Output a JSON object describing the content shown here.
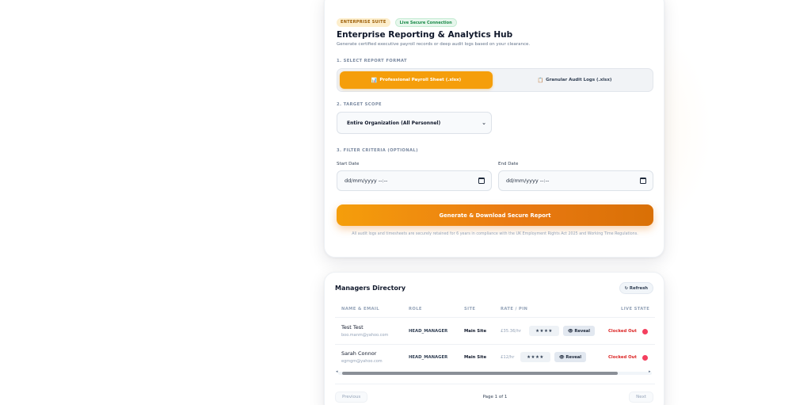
{
  "report": {
    "badge_enterprise": "ENTERPRISE SUITE",
    "badge_secure": "Live Secure Connection",
    "title": "Enterprise Reporting & Analytics Hub",
    "subtitle": "Generate certified executive payroll records or deep audit logs based on your clearance.",
    "section1_label": "1. SELECT REPORT FORMAT",
    "format_options": [
      {
        "label": "Professional Payroll Sheet (.xlsx)",
        "icon": "📊",
        "active": true
      },
      {
        "label": "Granular Audit Logs (.xlsx)",
        "icon": "📋",
        "active": false
      }
    ],
    "section2_label": "2. TARGET SCOPE",
    "scope_value": "Entire Organization (All Personnel)",
    "section3_label": "3. FILTER CRITERIA (OPTIONAL)",
    "start_label": "Start Date",
    "end_label": "End Date",
    "start_placeholder": "dd/mm/yyyy --:--",
    "end_placeholder": "dd/mm/yyyy --:--",
    "generate_label": "Generate & Download Secure Report",
    "footnote": "All audit logs and timesheets are securely retained for 6 years in compliance with the UK Employment Rights Act 2025 and Working Time Regulations."
  },
  "directory": {
    "title": "Managers Directory",
    "refresh_label": "↻ Refresh",
    "columns": [
      "NAME & EMAIL",
      "ROLE",
      "SITE",
      "RATE / PIN",
      "LIVE STATE"
    ],
    "rows": [
      {
        "name": "Test Test",
        "email": "boo.manm@yahoo.com",
        "role": "HEAD_MANAGER",
        "site": "Main Site",
        "rate": "£35.36/hr",
        "pin": "★★★★",
        "reveal": "👁 Reveal",
        "state": "Clocked Out"
      },
      {
        "name": "Sarah Connor",
        "email": "egmgm@yahoo.com",
        "role": "HEAD_MANAGER",
        "site": "Main Site",
        "rate": "£12/hr",
        "pin": "★★★★",
        "reveal": "👁 Reveal",
        "state": "Clocked Out"
      }
    ],
    "prev_label": "Previous",
    "page_info": "Page 1 of 1",
    "next_label": "Next"
  },
  "colors": {
    "accent": "#f59e0b",
    "danger": "#dc2626"
  }
}
